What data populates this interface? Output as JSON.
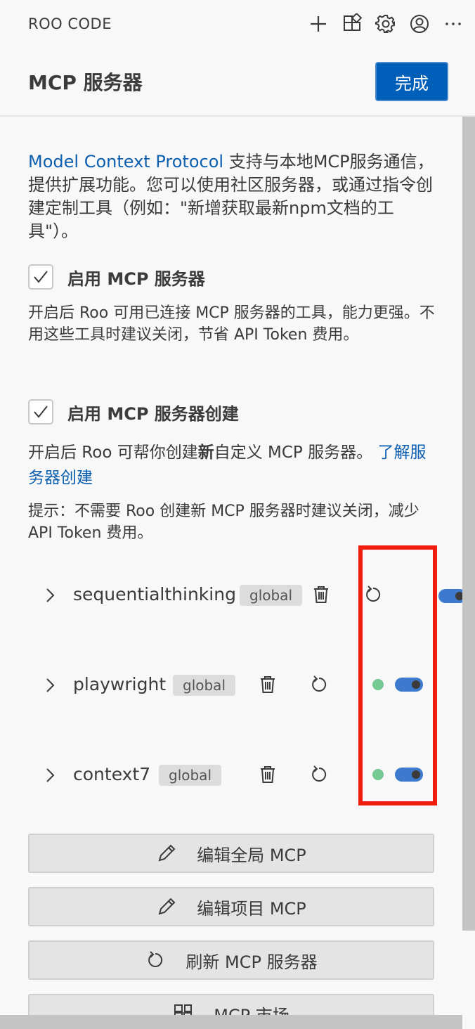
{
  "panel": {
    "title": "ROO CODE",
    "actions": [
      "plus-icon",
      "extensions-icon",
      "gear-icon",
      "account-icon",
      "more-icon"
    ]
  },
  "header": {
    "title": "MCP 服务器",
    "done_label": "完成"
  },
  "intro": {
    "link_text": "Model Context Protocol",
    "text": " 支持与本地MCP服务通信，提供扩展功能。您可以使用社区服务器，或通过指令创建定制工具（例如：\"新增获取最新npm文档的工具\"）。"
  },
  "enable_mcp": {
    "label": "启用 MCP 服务器",
    "checked": true,
    "description": "开启后 Roo 可用已连接 MCP 服务器的工具，能力更强。不用这些工具时建议关闭，节省 API Token 费用。"
  },
  "enable_creation": {
    "label": "启用 MCP 服务器创建",
    "checked": true,
    "description_pre": "开启后 Roo 可帮你创建",
    "description_bold": "新",
    "description_post": "自定义 MCP 服务器。 ",
    "learn_link": "了解服务器创建",
    "tip": "提示：不需要 Roo 创建新 MCP 服务器时建议关闭，减少 API Token 费用。"
  },
  "servers": [
    {
      "name": "sequentialthinking",
      "scope": "global",
      "enabled": true,
      "status_color": "",
      "status": "connecting"
    },
    {
      "name": "playwright",
      "scope": "global",
      "enabled": true,
      "status_color": "#73c991",
      "status": "connected"
    },
    {
      "name": "context7",
      "scope": "global",
      "enabled": true,
      "status_color": "#73c991",
      "status": "connected"
    }
  ],
  "buttons": {
    "edit_global": "编辑全局 MCP",
    "edit_project": "编辑项目 MCP",
    "refresh": "刷新 MCP 服务器",
    "marketplace": "MCP 市场"
  },
  "colors": {
    "accent": "#005fb8",
    "link": "#0d5fb0",
    "toggle_on": "#3d7acd",
    "status_ok": "#73c991",
    "highlight": "#f01d0f"
  }
}
